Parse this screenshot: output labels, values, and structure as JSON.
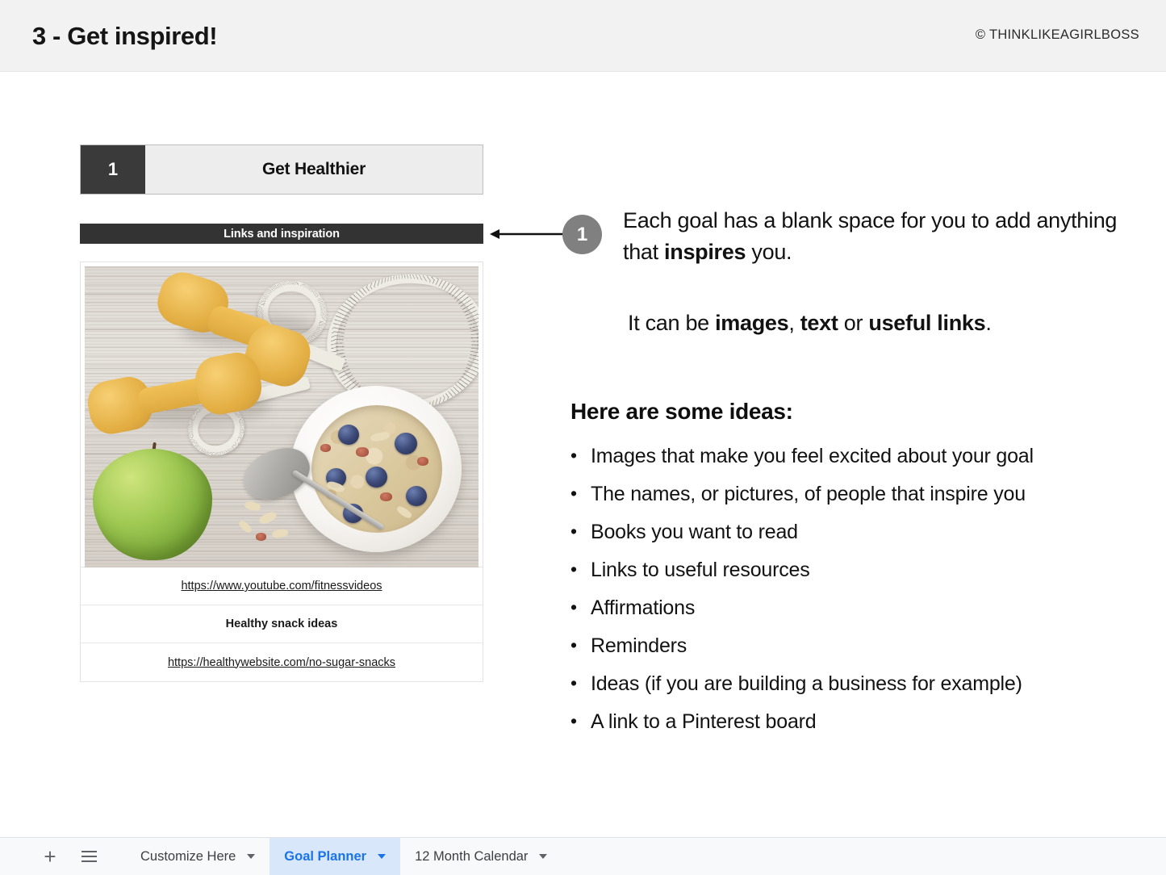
{
  "header": {
    "title_number": "3",
    "title_sep": "-",
    "title_text": "Get inspired!",
    "title_full": "3 - Get inspired!",
    "copyright": "© THINKLIKEAGIRLBOSS"
  },
  "goal": {
    "number": "1",
    "name": "Get Healthier",
    "links_bar_label": "Links and inspiration",
    "rows": [
      {
        "text": "https://www.youtube.com/fitnessvideos",
        "style": "link"
      },
      {
        "text": "Healthy snack ideas",
        "style": "bold"
      },
      {
        "text": "https://healthywebsite.com/no-sugar-snacks",
        "style": "link"
      }
    ],
    "image_alt": "yellow dumbbells, green apple, measuring tape and a bowl of muesli with blueberries on weathered wood"
  },
  "callout": {
    "badge": "1",
    "line1_a": "Each goal has a blank space for you to add anything that ",
    "line1_b": "inspires",
    "line1_c": " you.",
    "line2_a": "It can be ",
    "line2_b": "images",
    "line2_c": ", ",
    "line2_d": "text",
    "line2_e": " or ",
    "line2_f": "useful links",
    "line2_g": "."
  },
  "ideas": {
    "heading": "Here are some ideas:",
    "items": [
      "Images that make you feel excited about your goal",
      "The names, or pictures, of people that inspire you",
      "Books you want to read",
      "Links to useful resources",
      "Affirmations",
      "Reminders",
      "Ideas (if you are building a business for example)",
      "A link to a Pinterest board"
    ]
  },
  "tabbar": {
    "add_icon": "plus-icon",
    "menu_icon": "all-sheets-icon",
    "tabs": [
      {
        "label": "Customize Here",
        "active": false
      },
      {
        "label": "Goal Planner",
        "active": true
      },
      {
        "label": "12 Month Calendar",
        "active": false
      }
    ]
  },
  "colors": {
    "header_bg": "#f2f2f2",
    "dark_bar": "#333333",
    "goal_num_bg": "#3a3a3a",
    "goal_name_bg": "#ededed",
    "badge_gray": "#808080",
    "tab_active_bg": "#d9e7fb",
    "tab_active_text": "#1a73e8",
    "tabbar_bg": "#f8f9fa",
    "dumbbell_yellow": "#e8b44a",
    "apple_green": "#8dbd4a"
  }
}
